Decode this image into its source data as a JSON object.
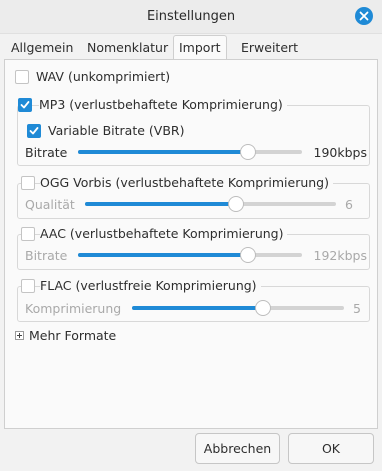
{
  "window": {
    "title": "Einstellungen",
    "close_icon": "close-icon",
    "accent_color": "#1f8ad6"
  },
  "tabs": [
    {
      "label": "Allgemein",
      "active": false
    },
    {
      "label": "Nomenklatur",
      "active": false
    },
    {
      "label": "Import",
      "active": true
    },
    {
      "label": "Erweitert",
      "active": false
    }
  ],
  "formats": {
    "wav": {
      "label": "WAV (unkomprimiert)",
      "checked": false
    },
    "mp3": {
      "label": "MP3 (verlustbehaftete Komprimierung)",
      "checked": true,
      "vbr": {
        "label": "Variable Bitrate (VBR)",
        "checked": true
      },
      "slider": {
        "label": "Bitrate",
        "value": "190kbps",
        "fraction": 0.76,
        "enabled": true
      }
    },
    "ogg": {
      "label": "OGG Vorbis (verlustbehaftete Komprimierung)",
      "checked": false,
      "slider": {
        "label": "Qualität",
        "value": "6",
        "fraction": 0.6,
        "enabled": false
      }
    },
    "aac": {
      "label": "AAC (verlustbehaftete Komprimierung)",
      "checked": false,
      "slider": {
        "label": "Bitrate",
        "value": "192kbps",
        "fraction": 0.76,
        "enabled": false
      }
    },
    "flac": {
      "label": "FLAC (verlustfreie Komprimierung)",
      "checked": false,
      "slider": {
        "label": "Komprimierung",
        "value": "5",
        "fraction": 0.62,
        "enabled": false
      }
    }
  },
  "more_formats": {
    "label": "Mehr Formate",
    "icon": "expand-plus-icon",
    "expanded": false
  },
  "buttons": {
    "cancel": "Abbrechen",
    "ok": "OK"
  }
}
